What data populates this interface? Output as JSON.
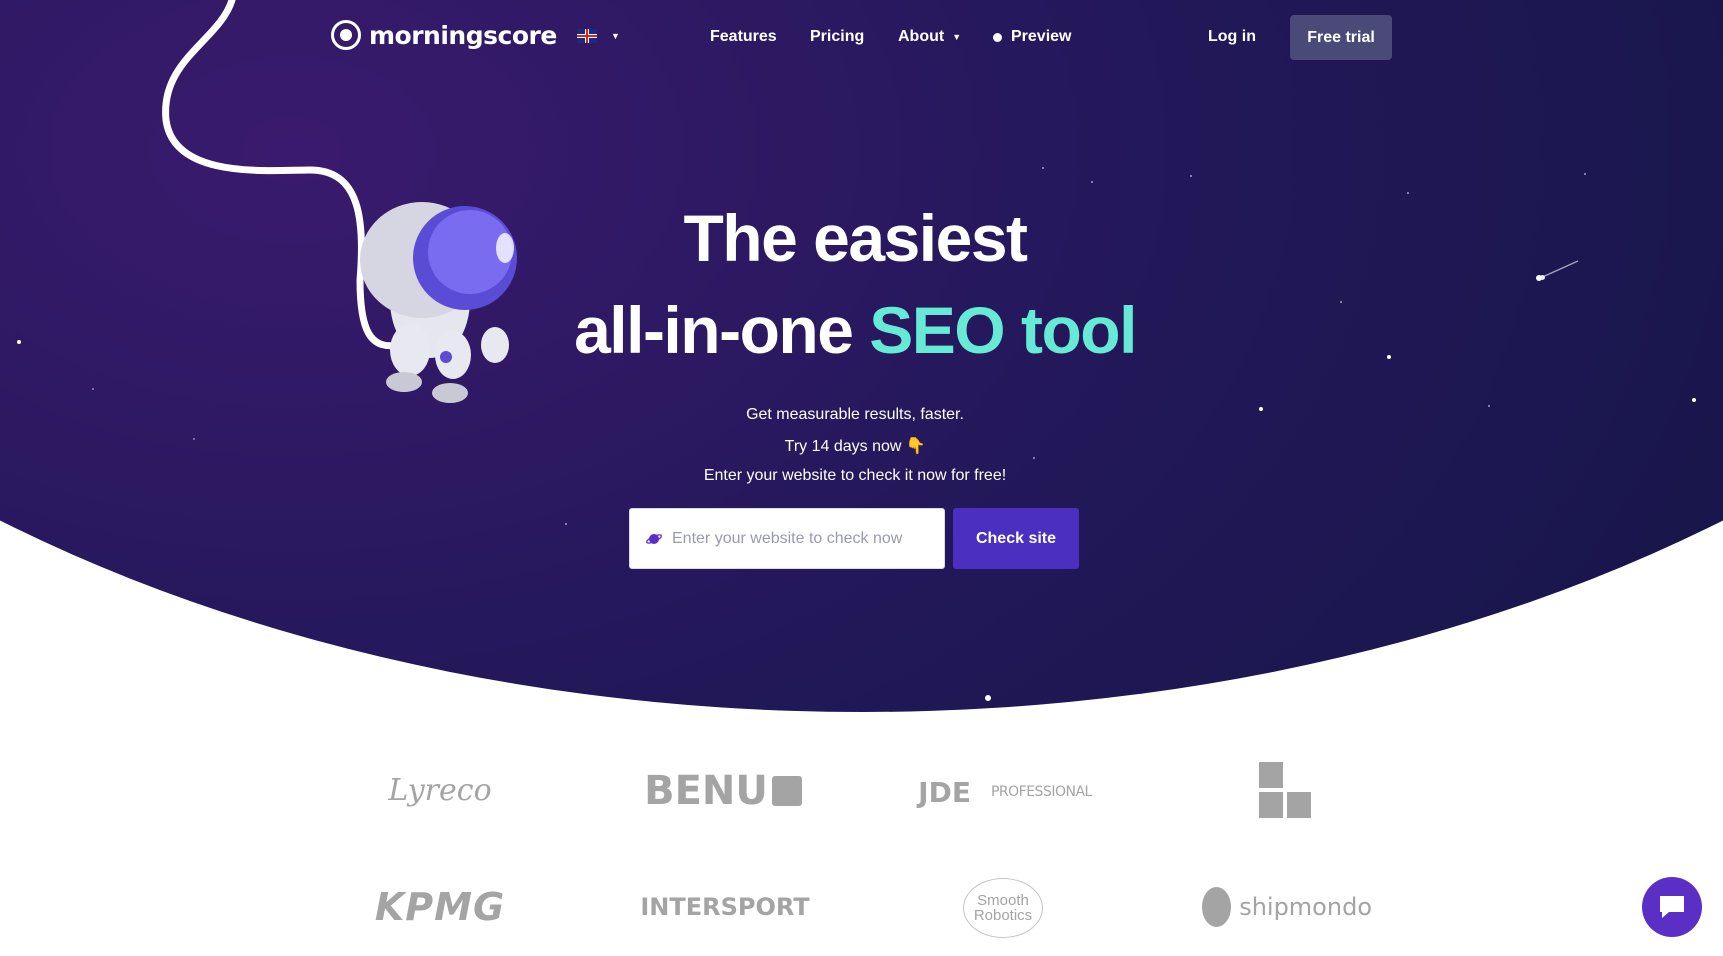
{
  "brand": {
    "name": "morningscore",
    "accent_color": "#66ead6",
    "button_color": "#4b2fc0",
    "dark_bg": "#161648"
  },
  "nav": {
    "language_icon": "uk-flag-icon",
    "links": {
      "features": "Features",
      "pricing": "Pricing",
      "about": "About",
      "preview": "Preview"
    },
    "login": "Log in",
    "free_trial": "Free trial"
  },
  "hero": {
    "title_line1": "The easiest",
    "title_line2_plain": "all-in-one ",
    "title_line2_accent": "SEO tool",
    "subtitle1": "Get measurable results, faster.",
    "subtitle2": "Try 14 days now",
    "subtitle2_emoji": "👇",
    "subtitle3": "Enter your website to check it now for free!",
    "search_placeholder": "Enter your website to check now",
    "check_button": "Check site"
  },
  "clients": {
    "lyreco": "Lyreco",
    "benu": "BENU",
    "jde": "JDE",
    "jde_professional": "PROFESSIONAL",
    "eg": "EG",
    "kpmg": "KPMG",
    "intersport": "INTERSPORT",
    "smooth_line1": "Smooth",
    "smooth_line2": "Robotics",
    "shipmondo": "shipmondo"
  },
  "chat": {
    "icon": "chat-bubble-icon"
  }
}
